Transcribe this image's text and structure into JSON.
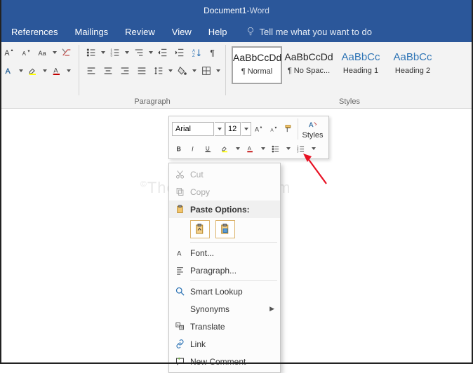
{
  "title": {
    "doc": "Document1",
    "sep": "  -  ",
    "app": "Word"
  },
  "menubar": {
    "references": "References",
    "mailings": "Mailings",
    "review": "Review",
    "view": "View",
    "help": "Help",
    "tellme": "Tell me what you want to do"
  },
  "ribbon": {
    "paragraph_label": "Paragraph",
    "styles_label": "Styles",
    "styles": [
      {
        "preview": "AaBbCcDd",
        "name": "¶ Normal"
      },
      {
        "preview": "AaBbCcDd",
        "name": "¶ No Spac..."
      },
      {
        "preview": "AaBbCc",
        "name": "Heading 1"
      },
      {
        "preview": "AaBbCc",
        "name": "Heading 2"
      }
    ]
  },
  "minibar": {
    "font": "Arial",
    "size": "12",
    "styles_label": "Styles"
  },
  "context": {
    "cut": "Cut",
    "copy": "Copy",
    "paste_header": "Paste Options:",
    "font": "Font...",
    "paragraph": "Paragraph...",
    "smart_lookup": "Smart Lookup",
    "synonyms": "Synonyms",
    "translate": "Translate",
    "link": "Link",
    "new_comment": "New Comment"
  },
  "watermark": {
    "c": "©",
    "text": "TheGeekPage.com"
  }
}
